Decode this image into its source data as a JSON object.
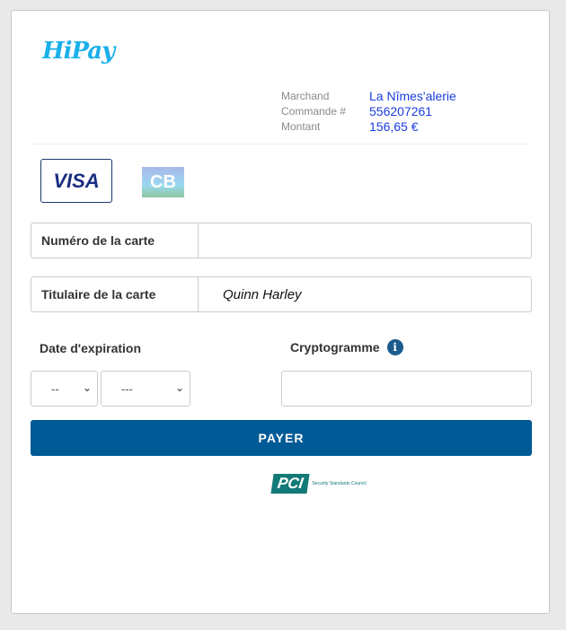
{
  "logo": "HiPay",
  "merchant": {
    "label": "Marchand",
    "value": "La Nîmes'alerie"
  },
  "order": {
    "label": "Commande #",
    "value": "556207261"
  },
  "amount": {
    "label": "Montant",
    "value": "156,65 €"
  },
  "cards": {
    "visa": "VISA",
    "cb": "CB"
  },
  "form": {
    "card_number_label": "Numéro de la carte",
    "card_number_value": "",
    "holder_label": "Titulaire de la carte",
    "holder_value": "Quinn Harley",
    "expiry_label": "Date d'expiration",
    "month_value": "--",
    "year_value": "---",
    "cvv_label": "Cryptogramme",
    "cvv_value": ""
  },
  "pay_label": "PAYER",
  "pci": {
    "badge": "PCI",
    "text": "Security Standards Council"
  }
}
